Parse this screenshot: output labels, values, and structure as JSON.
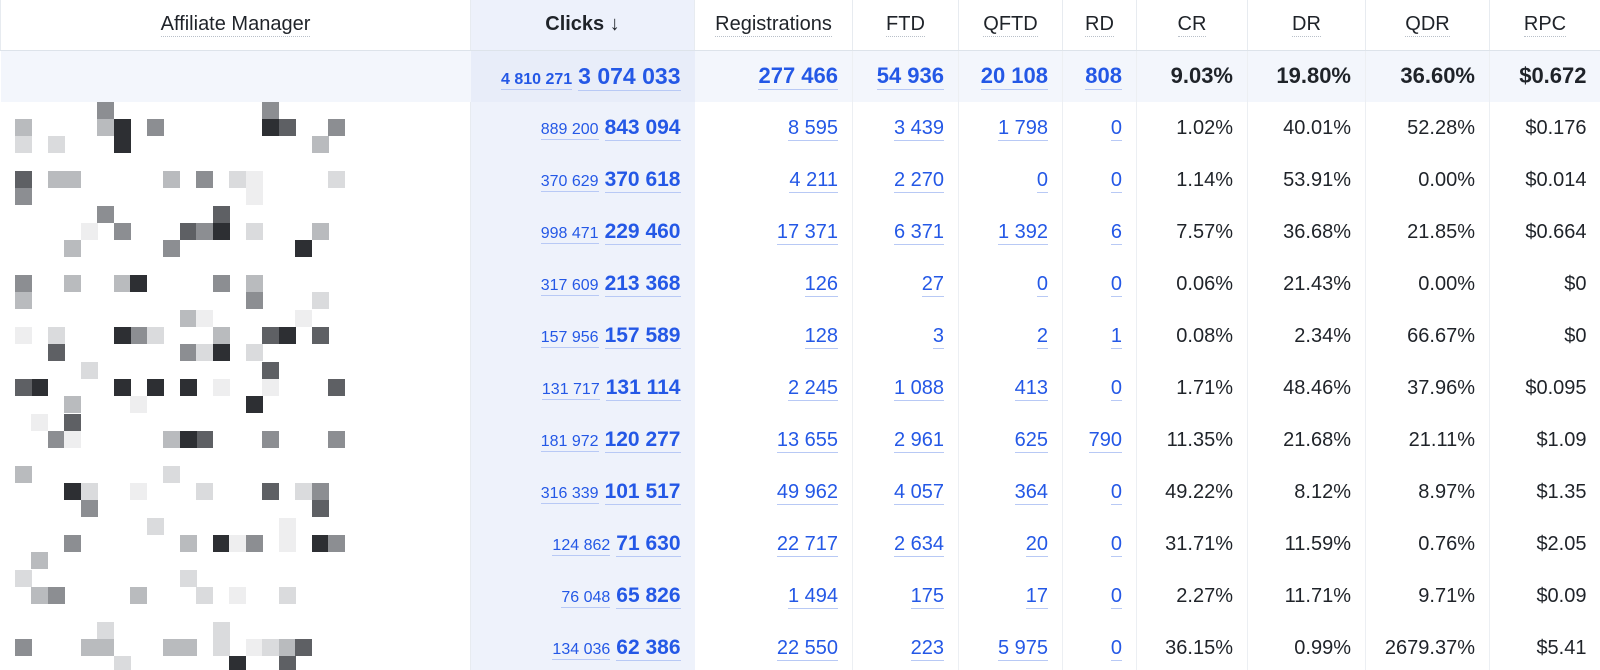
{
  "table": {
    "columns": [
      {
        "key": "manager",
        "label": "Affiliate Manager"
      },
      {
        "key": "clicks",
        "label": "Clicks ↓"
      },
      {
        "key": "registrations",
        "label": "Registrations"
      },
      {
        "key": "ftd",
        "label": "FTD"
      },
      {
        "key": "qftd",
        "label": "QFTD"
      },
      {
        "key": "rd",
        "label": "RD"
      },
      {
        "key": "cr",
        "label": "CR"
      },
      {
        "key": "dr",
        "label": "DR"
      },
      {
        "key": "qdr",
        "label": "QDR"
      },
      {
        "key": "rpc",
        "label": "RPC"
      }
    ],
    "totals": {
      "clicks_prev": "4 810 271",
      "clicks": "3 074 033",
      "registrations": "277 466",
      "ftd": "54 936",
      "qftd": "20 108",
      "rd": "808",
      "cr": "9.03%",
      "dr": "19.80%",
      "qdr": "36.60%",
      "rpc": "$0.672"
    },
    "rows": [
      {
        "clicks_prev": "889 200",
        "clicks": "843 094",
        "registrations": "8 595",
        "ftd": "3 439",
        "qftd": "1 798",
        "rd": "0",
        "cr": "1.02%",
        "dr": "40.01%",
        "qdr": "52.28%",
        "rpc": "$0.176"
      },
      {
        "clicks_prev": "370 629",
        "clicks": "370 618",
        "registrations": "4 211",
        "ftd": "2 270",
        "qftd": "0",
        "rd": "0",
        "cr": "1.14%",
        "dr": "53.91%",
        "qdr": "0.00%",
        "rpc": "$0.014"
      },
      {
        "clicks_prev": "998 471",
        "clicks": "229 460",
        "registrations": "17 371",
        "ftd": "6 371",
        "qftd": "1 392",
        "rd": "6",
        "cr": "7.57%",
        "dr": "36.68%",
        "qdr": "21.85%",
        "rpc": "$0.664"
      },
      {
        "clicks_prev": "317 609",
        "clicks": "213 368",
        "registrations": "126",
        "ftd": "27",
        "qftd": "0",
        "rd": "0",
        "cr": "0.06%",
        "dr": "21.43%",
        "qdr": "0.00%",
        "rpc": "$0"
      },
      {
        "clicks_prev": "157 956",
        "clicks": "157 589",
        "registrations": "128",
        "ftd": "3",
        "qftd": "2",
        "rd": "1",
        "cr": "0.08%",
        "dr": "2.34%",
        "qdr": "66.67%",
        "rpc": "$0"
      },
      {
        "clicks_prev": "131 717",
        "clicks": "131 114",
        "registrations": "2 245",
        "ftd": "1 088",
        "qftd": "413",
        "rd": "0",
        "cr": "1.71%",
        "dr": "48.46%",
        "qdr": "37.96%",
        "rpc": "$0.095"
      },
      {
        "clicks_prev": "181 972",
        "clicks": "120 277",
        "registrations": "13 655",
        "ftd": "2 961",
        "qftd": "625",
        "rd": "790",
        "cr": "11.35%",
        "dr": "21.68%",
        "qdr": "21.11%",
        "rpc": "$1.09"
      },
      {
        "clicks_prev": "316 339",
        "clicks": "101 517",
        "registrations": "49 962",
        "ftd": "4 057",
        "qftd": "364",
        "rd": "0",
        "cr": "49.22%",
        "dr": "8.12%",
        "qdr": "8.97%",
        "rpc": "$1.35"
      },
      {
        "clicks_prev": "124 862",
        "clicks": "71 630",
        "registrations": "22 717",
        "ftd": "2 634",
        "qftd": "20",
        "rd": "0",
        "cr": "31.71%",
        "dr": "11.59%",
        "qdr": "0.76%",
        "rpc": "$2.05"
      },
      {
        "clicks_prev": "76 048",
        "clicks": "65 826",
        "registrations": "1 494",
        "ftd": "175",
        "qftd": "17",
        "rd": "0",
        "cr": "2.27%",
        "dr": "11.71%",
        "qdr": "9.71%",
        "rpc": "$0.09"
      },
      {
        "clicks_prev": "134 036",
        "clicks": "62 386",
        "registrations": "22 550",
        "ftd": "223",
        "qftd": "5 975",
        "rd": "0",
        "cr": "36.15%",
        "dr": "0.99%",
        "qdr": "2679.37%",
        "rpc": "$5.41"
      }
    ]
  },
  "colors": {
    "link": "#2458e6",
    "clicks_column_bg": "#eef2fb",
    "totals_row_bg": "#f3f6fc"
  }
}
